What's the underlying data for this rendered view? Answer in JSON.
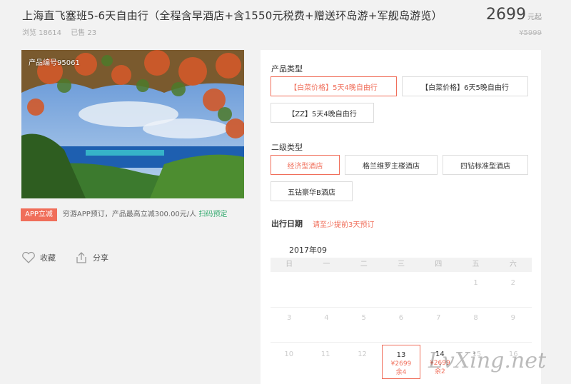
{
  "header": {
    "title": "上海直飞塞班5-6天自由行（全程含早酒店+含1550元税费+赠送环岛游+军舰岛游览）",
    "views": "浏览 18614",
    "sold": "已售 23",
    "price": "2699",
    "price_unit": "元起",
    "old_price": "¥5999"
  },
  "gallery": {
    "code_label": "产品编号95061"
  },
  "promo": {
    "badge": "APP立减",
    "text": "穷游APP预订，产品最高立减300.00元/人",
    "link": "扫码预定"
  },
  "actions": {
    "favorite": "收藏",
    "share": "分享"
  },
  "booking": {
    "product_type_label": "产品类型",
    "product_types": [
      "【白菜价格】5天4晚自由行",
      "【白菜价格】6天5晚自由行",
      "【ZZ】5天4晚自由行"
    ],
    "sub_type_label": "二级类型",
    "sub_types": [
      "经济型酒店",
      "格兰维罗主楼酒店",
      "四钻标准型酒店",
      "五钻豪华B酒店"
    ],
    "date_label": "出行日期",
    "date_note": "请至少提前3天预订",
    "month": "2017年09",
    "weekdays": [
      "日",
      "一",
      "二",
      "三",
      "四",
      "五",
      "六"
    ],
    "row1": [
      "",
      "",
      "",
      "",
      "",
      "1",
      "2"
    ],
    "row2": [
      "3",
      "4",
      "5",
      "6",
      "7",
      "8",
      "9"
    ],
    "row3": [
      "10",
      "11",
      "12",
      "13",
      "14",
      "15",
      "16"
    ],
    "d13_price": "¥2699",
    "d13_remain": "余4",
    "d14_price": "¥2699",
    "d14_remain": "余2"
  },
  "watermark": "LvXing.net"
}
